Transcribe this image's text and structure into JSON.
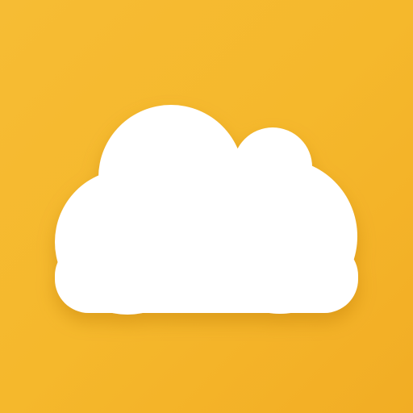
{
  "app_icon": {
    "icon": "cloud-icon",
    "colors": {
      "background": "#f5b82c",
      "cloud": "#ffffff",
      "shadow": "#b87400"
    }
  }
}
